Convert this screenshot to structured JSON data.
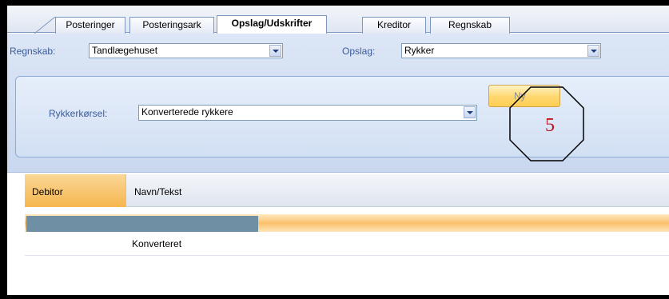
{
  "tabs": [
    {
      "label": "Posteringer",
      "active": false
    },
    {
      "label": "Posteringsark",
      "active": false
    },
    {
      "label": "Opslag/Udskrifter",
      "active": true
    },
    {
      "label": "Kreditor",
      "active": false
    },
    {
      "label": "Regnskab",
      "active": false
    }
  ],
  "filters": {
    "regnskab_label": "Regnskab:",
    "regnskab_value": "Tandlægehuset",
    "opslag_label": "Opslag:",
    "opslag_value": "Rykker"
  },
  "rykker": {
    "label": "Rykkerkørsel:",
    "value": "Konverterede rykkere",
    "new_button": "Ny"
  },
  "annotation": {
    "number": "5",
    "shape": "octagon"
  },
  "grid": {
    "columns": [
      "Debitor",
      "Navn/Tekst"
    ],
    "rows": [
      {
        "debitor": "",
        "navn": "Konverteret"
      }
    ]
  },
  "colors": {
    "accent": "#f5b64f",
    "panel": "#d2e0f4",
    "annotation_text": "#c0141b",
    "group_bar": "#6f8fa5"
  }
}
